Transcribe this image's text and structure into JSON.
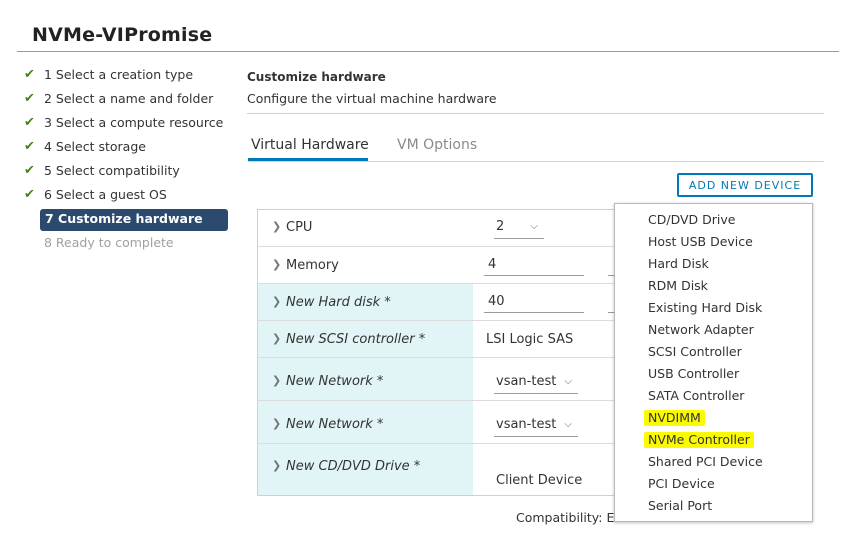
{
  "window": {
    "title": "NVMe-VIPromise"
  },
  "steps": [
    {
      "label": "1 Select a creation type",
      "state": "done"
    },
    {
      "label": "2 Select a name and folder",
      "state": "done"
    },
    {
      "label": "3 Select a compute resource",
      "state": "done"
    },
    {
      "label": "4 Select storage",
      "state": "done"
    },
    {
      "label": "5 Select compatibility",
      "state": "done"
    },
    {
      "label": "6 Select a guest OS",
      "state": "done"
    },
    {
      "label": "7 Customize hardware",
      "state": "active"
    },
    {
      "label": "8 Ready to complete",
      "state": "disabled"
    }
  ],
  "section": {
    "title": "Customize hardware",
    "subtitle": "Configure the virtual machine hardware"
  },
  "tabs": [
    {
      "label": "Virtual Hardware",
      "active": true
    },
    {
      "label": "VM Options",
      "active": false
    }
  ],
  "add_device_button": "ADD NEW DEVICE",
  "hardware": [
    {
      "name": "CPU",
      "value": "2",
      "control": "select",
      "new": false
    },
    {
      "name": "Memory",
      "value": "4",
      "control": "field",
      "new": false
    },
    {
      "name": "New Hard disk *",
      "value": "40",
      "control": "field",
      "new": true
    },
    {
      "name": "New SCSI controller *",
      "value": "LSI Logic SAS",
      "control": "text",
      "new": true
    },
    {
      "name": "New Network *",
      "value": "vsan-test",
      "control": "select",
      "new": true
    },
    {
      "name": "New Network *",
      "value": "vsan-test",
      "control": "select",
      "new": true
    },
    {
      "name": "New CD/DVD Drive *",
      "value": "Client Device",
      "control": "text",
      "new": true
    }
  ],
  "compatibility": "Compatibility: E",
  "device_menu": [
    {
      "label": "CD/DVD Drive",
      "highlighted": false
    },
    {
      "label": "Host USB Device",
      "highlighted": false
    },
    {
      "label": "Hard Disk",
      "highlighted": false
    },
    {
      "label": "RDM Disk",
      "highlighted": false
    },
    {
      "label": "Existing Hard Disk",
      "highlighted": false
    },
    {
      "label": "Network Adapter",
      "highlighted": false
    },
    {
      "label": "SCSI Controller",
      "highlighted": false
    },
    {
      "label": "USB Controller",
      "highlighted": false
    },
    {
      "label": "SATA Controller",
      "highlighted": false
    },
    {
      "label": "NVDIMM",
      "highlighted": true
    },
    {
      "label": "NVMe Controller",
      "highlighted": true
    },
    {
      "label": "Shared PCI Device",
      "highlighted": false
    },
    {
      "label": "PCI Device",
      "highlighted": false
    },
    {
      "label": "Serial Port",
      "highlighted": false
    }
  ],
  "colors": {
    "accent": "#0079b8",
    "active_step_bg": "#2c4a6e",
    "check": "#3f8a17",
    "new_row_bg": "#e1f4f6",
    "highlighter": "#fafa00"
  },
  "icons": {
    "step_done": "checkmark-icon",
    "row_expand": "chevron-right-icon",
    "select_caret": "chevron-down-icon"
  }
}
